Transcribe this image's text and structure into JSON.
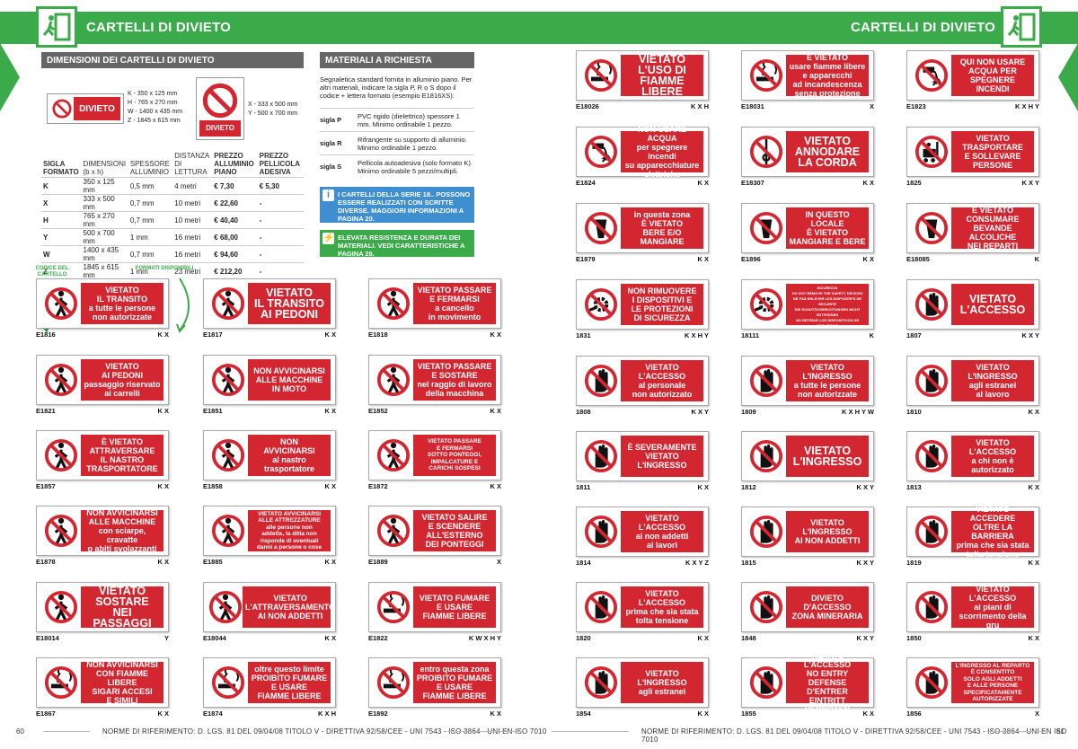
{
  "header": {
    "title_left": "CARTELLI DI DIVIETO",
    "title_right": "CARTELLI DI DIVIETO"
  },
  "dimensions": {
    "heading": "DIMENSIONI DEI CARTELLI DI DIVIETO",
    "landscape_sample": "DIVIETO",
    "portrait_sample": "DIVIETO",
    "landscape_formats": [
      "K - 350 x 125 mm",
      "H - 765 x 270 mm",
      "W - 1400 x 435 mm",
      "Z - 1845 x 615 mm"
    ],
    "portrait_formats": [
      "X - 333 x 500 mm",
      "Y - 500 x 700 mm"
    ],
    "columns": [
      "SIGLA FORMATO",
      "DIMENSIONI (b x h)",
      "SPESSORE ALLUMINIO",
      "DISTANZA DI LETTURA",
      "PREZZO ALLUMINIO PIANO",
      "PREZZO PELLICOLA ADESIVA"
    ],
    "rows": [
      [
        "K",
        "350 x 125 mm",
        "0,5 mm",
        "4 metri",
        "€ 7,30",
        "€ 5,30"
      ],
      [
        "X",
        "333 x 500 mm",
        "0,7 mm",
        "10 metri",
        "€ 22,60",
        "-"
      ],
      [
        "H",
        "765 x 270 mm",
        "0,7 mm",
        "10 metri",
        "€ 40,40",
        "-"
      ],
      [
        "Y",
        "500 x 700 mm",
        "1 mm",
        "16 metri",
        "€ 68,00",
        "-"
      ],
      [
        "W",
        "1400 x 435 mm",
        "0,7 mm",
        "16 metri",
        "€ 94,60",
        "-"
      ],
      [
        "Z",
        "1845 x 615 mm",
        "1 mm",
        "23 metri",
        "€ 212,20",
        "-"
      ]
    ]
  },
  "materials": {
    "heading": "MATERIALI A RICHIESTA",
    "intro": "Segnaletica standard fornita in alluminio piano. Per altri materiali, indicare la sigla P, R o S dopo il codice + lettera formato (esempio E1816XS):",
    "items": [
      {
        "key": "sigla P",
        "desc": "PVC rigido (dielettrico) spessore 1 mm. Minimo ordinabile 1 pezzo."
      },
      {
        "key": "sigla R",
        "desc": "Rifrangente su supporto di alluminio. Minimo ordinabile 1 pezzo."
      },
      {
        "key": "sigla S",
        "desc": "Pellicola autoadesiva (solo formato K). Minimo ordinabile 5 pezzi/multipli."
      }
    ],
    "info_blue": "I CARTELLI DELLA SERIE 18.. POSSONO ESSERE REALIZZATI CON SCRITTE DIVERSE. MAGGIORI INFORMAZIONI A PAGINA 20.",
    "info_green": "ELEVATA RESISTENZA E DURATA DEI MATERIALI. VEDI CARATTERISTICHE A PAGINA 26."
  },
  "captions": {
    "code": "CODICE DEL CARTELLO",
    "formats": "FORMATI DISPONIBILI"
  },
  "left_signs": [
    {
      "code": "E1816",
      "formats": "K X",
      "text": "VIETATO\nIL TRANSITO\na tutte le persone\nnon autorizzate",
      "icon": "no-pedestrian-icon",
      "size": ""
    },
    {
      "code": "E1817",
      "formats": "K X",
      "text": "VIETATO\nIL TRANSITO\nAI PEDONI",
      "icon": "no-pedestrian-icon",
      "size": "big"
    },
    {
      "code": "E1818",
      "formats": "K X",
      "text": "VIETATO PASSARE\nE FERMARSI\na cancello\nin movimento",
      "icon": "no-pedestrian-icon",
      "size": ""
    },
    {
      "code": "E1821",
      "formats": "K X",
      "text": "VIETATO\nAI PEDONI\npassaggio riservato\nai carrelli",
      "icon": "no-pedestrian-icon",
      "size": ""
    },
    {
      "code": "E1851",
      "formats": "K X",
      "text": "NON AVVICINARSI\nALLE MACCHINE\nIN MOTO",
      "icon": "no-pedestrian-icon",
      "size": ""
    },
    {
      "code": "E1852",
      "formats": "K X",
      "text": "VIETATO PASSARE\nE SOSTARE\nnel raggio di lavoro\ndella macchina",
      "icon": "no-pedestrian-icon",
      "size": ""
    },
    {
      "code": "E1857",
      "formats": "K X",
      "text": "È VIETATO\nATTRAVERSARE\nIL NASTRO\nTRASPORTATORE",
      "icon": "no-pedestrian-icon",
      "size": ""
    },
    {
      "code": "E1858",
      "formats": "K X",
      "text": "NON\nAVVICINARSI\nal nastro\ntrasportatore",
      "icon": "no-pedestrian-icon",
      "size": ""
    },
    {
      "code": "E1872",
      "formats": "K X",
      "text": "VIETATO PASSARE\nE FERMARSI\nSOTTO PONTEGGI,\nIMPALCATURE E\nCARICHI SOSPESI",
      "icon": "no-pedestrian-icon",
      "size": "small"
    },
    {
      "code": "E1878",
      "formats": "K X",
      "text": "NON AVVICINARSI\nALLE MACCHINE\ncon sciarpe, cravatte\no abiti svolazzanti",
      "icon": "no-pedestrian-icon",
      "size": ""
    },
    {
      "code": "E1885",
      "formats": "K X",
      "text": "VIETATO AVVICINARSI\nALLE ATTREZZATURE\nalle persone non\naddette, la ditta non\nrisponde di eventuali\ndanni a persone o cose",
      "icon": "no-pedestrian-icon",
      "size": "small"
    },
    {
      "code": "E1889",
      "formats": "X",
      "text": "VIETATO SALIRE\nE SCENDERE\nALL'ESTERNO\nDEI PONTEGGI",
      "icon": "no-pedestrian-icon",
      "size": ""
    },
    {
      "code": "E18014",
      "formats": "Y",
      "text": "VIETATO\nSOSTARE\nNEI PASSAGGI",
      "icon": "no-pedestrian-icon",
      "size": "big"
    },
    {
      "code": "E18044",
      "formats": "K X",
      "text": "VIETATO\nL'ATTRAVERSAMENTO\nAI NON ADDETTI",
      "icon": "no-pedestrian-icon",
      "size": ""
    },
    {
      "code": "E1822",
      "formats": "K W X H Y",
      "text": "VIETATO FUMARE\nE USARE\nFIAMME LIBERE",
      "icon": "no-smoking-icon",
      "size": ""
    },
    {
      "code": "E1867",
      "formats": "K X",
      "text": "NON AVVICINARSI\nCON FIAMME LIBERE\nSIGARI ACCESI\nE SIMILI",
      "icon": "no-smoking-icon",
      "size": ""
    },
    {
      "code": "E1874",
      "formats": "K X H",
      "text": "oltre questo limite\nPROIBITO FUMARE\nE USARE\nFIAMME LIBERE",
      "icon": "no-smoking-icon",
      "size": ""
    },
    {
      "code": "E1892",
      "formats": "K X",
      "text": "entro questa zona\nPROIBITO FUMARE\nE USARE\nFIAMME LIBERE",
      "icon": "no-smoking-icon",
      "size": ""
    }
  ],
  "right_signs": [
    {
      "code": "E18026",
      "formats": "K X H",
      "text": "VIETATO\nL'USO DI\nFIAMME LIBERE",
      "icon": "no-smoking-icon",
      "size": "big"
    },
    {
      "code": "E18031",
      "formats": "X",
      "text": "È VIETATO\nusare fiamme libere\ne apparecchi\nad incandescenza\nsenza protezione",
      "icon": "no-smoking-icon",
      "size": ""
    },
    {
      "code": "E1823",
      "formats": "K X H Y",
      "text": "QUI NON USARE\nACQUA PER\nSPEGNERE\nINCENDI",
      "icon": "no-water-icon",
      "size": ""
    },
    {
      "code": "E1824",
      "formats": "K X",
      "text": "NON USARE ACQUA\nper spegnere incendi\nsu apparecchiature\nelettriche",
      "icon": "no-water-icon",
      "size": ""
    },
    {
      "code": "E18307",
      "formats": "K X",
      "text": "VIETATO\nANNODARE\nLA CORDA",
      "icon": "no-knot-icon",
      "size": "big"
    },
    {
      "code": "1825",
      "formats": "K X Y",
      "text": "VIETATO\nTRASPORTARE\nE SOLLEVARE\nPERSONE",
      "icon": "no-forklift-icon",
      "size": ""
    },
    {
      "code": "E1879",
      "formats": "K X",
      "text": "in questa zona\nÈ VIETATO\nBERE E/O\nMANGIARE",
      "icon": "no-drink-icon",
      "size": ""
    },
    {
      "code": "E1896",
      "formats": "K X",
      "text": "IN QUESTO LOCALE\nÈ VIETATO\nMANGIARE E BERE",
      "icon": "no-drink-icon",
      "size": ""
    },
    {
      "code": "E18085",
      "formats": "K",
      "text": "È VIETATO\nCONSUMARE\nBEVANDE ALCOLICHE\nNEI REPARTI",
      "icon": "no-drink-icon",
      "size": ""
    },
    {
      "code": "1831",
      "formats": "K X H Y",
      "text": "NON RIMUOVERE\nI DISPOSITIVI E\nLE PROTEZIONI\nDI SICUREZZA",
      "icon": "no-remove-icon",
      "size": ""
    },
    {
      "code": "18111",
      "formats": "K",
      "text": "NON RIMUOVERE I DISPOSITIVI DI SICUREZZA\nDO NOT REMOVE THE SAFETY DEVICES\nNE PAS ENLEVER LES DISPOSITIFS DE SECURITE\nDIE SCHUTZVORRICHTUNGEN NICHT ENTFERNEN\nNO RETIRAR LOS DISPOSITIVOS DE SEGURIDAD",
      "icon": "no-remove-icon",
      "size": "tiny"
    },
    {
      "code": "1807",
      "formats": "K X Y",
      "text": "VIETATO\nL'ACCESSO",
      "icon": "no-access-hand-icon",
      "size": "big"
    },
    {
      "code": "1808",
      "formats": "K X Y",
      "text": "VIETATO\nL'ACCESSO\nal personale\nnon autorizzato",
      "icon": "no-access-hand-icon",
      "size": ""
    },
    {
      "code": "1809",
      "formats": "K X H Y W",
      "text": "VIETATO\nL'INGRESSO\na tutte le persone\nnon autorizzate",
      "icon": "no-access-hand-icon",
      "size": ""
    },
    {
      "code": "1810",
      "formats": "K X",
      "text": "VIETATO\nL'INGRESSO\nagli estranei\nal lavoro",
      "icon": "no-access-hand-icon",
      "size": ""
    },
    {
      "code": "1811",
      "formats": "K X",
      "text": "È SEVERAMENTE\nVIETATO\nL'INGRESSO",
      "icon": "no-access-hand-icon",
      "size": ""
    },
    {
      "code": "1812",
      "formats": "K X Y",
      "text": "VIETATO\nL'INGRESSO",
      "icon": "no-access-hand-icon",
      "size": "big"
    },
    {
      "code": "1813",
      "formats": "K X",
      "text": "VIETATO\nL'ACCESSO\na chi non è\nautorizzato",
      "icon": "no-access-hand-icon",
      "size": ""
    },
    {
      "code": "1814",
      "formats": "K X Y Z",
      "text": "VIETATO\nL'ACCESSO\nai non addetti\nai lavori",
      "icon": "no-access-hand-icon",
      "size": ""
    },
    {
      "code": "1815",
      "formats": "K X Y",
      "text": "VIETATO\nL'INGRESSO\nAI NON ADDETTI",
      "icon": "no-access-hand-icon",
      "size": ""
    },
    {
      "code": "1819",
      "formats": "K X",
      "text": "VIETATO ACCEDERE\nOLTRE LA BARRIERA\nprima che sia stata\ntolta tensione",
      "icon": "no-access-hand-icon",
      "size": ""
    },
    {
      "code": "1820",
      "formats": "K X",
      "text": "VIETATO\nL'ACCESSO\nprima che sia stata\ntolta tensione",
      "icon": "no-access-hand-icon",
      "size": ""
    },
    {
      "code": "1848",
      "formats": "K X Y",
      "text": "DIVIETO\nD'ACCESSO\nZONA MINERARIA",
      "icon": "no-access-hand-icon",
      "size": ""
    },
    {
      "code": "1850",
      "formats": "K X",
      "text": "VIETATO\nL'ACCESSO\nai piani di\nscorrimento della gru",
      "icon": "no-access-hand-icon",
      "size": ""
    },
    {
      "code": "1854",
      "formats": "K X",
      "text": "VIETATO\nL'INGRESSO\nagli estranei",
      "icon": "no-access-hand-icon",
      "size": ""
    },
    {
      "code": "1855",
      "formats": "K X",
      "text": "VIETATO L'ACCESSO\nNO ENTRY\nDEFENSE D'ENTRER\nEINTRITT VERBOTEN",
      "icon": "no-access-hand-icon",
      "size": ""
    },
    {
      "code": "1856",
      "formats": "X",
      "text": "L'INGRESSO AL REPARTO\nÈ CONSENTITO\nSOLO AGLI ADDETTI\nE ALLE PERSONE\nSPECIFICATAMENTE\nAUTORIZZATE",
      "icon": "no-access-hand-icon",
      "size": "small"
    }
  ],
  "footer": {
    "page_left": "60",
    "page_right": "61",
    "norms_left": "NORME DI RIFERIMENTO: D. LGS. 81 DEL 09/04/08 TITOLO V - DIRETTIVA 92/58/CEE - UNI 7543 - ISO 3864 - UNI EN ISO 7010",
    "norms_right": "NORME DI RIFERIMENTO: D. LGS. 81 DEL 09/04/08 TITOLO V - DIRETTIVA 92/58/CEE - UNI 7543 - ISO 3864 - UNI EN ISO 7010"
  },
  "colors": {
    "brand_green": "#3aaa4a",
    "sign_red": "#d22630",
    "heading_gray": "#666666",
    "info_blue": "#3f8fd0"
  }
}
